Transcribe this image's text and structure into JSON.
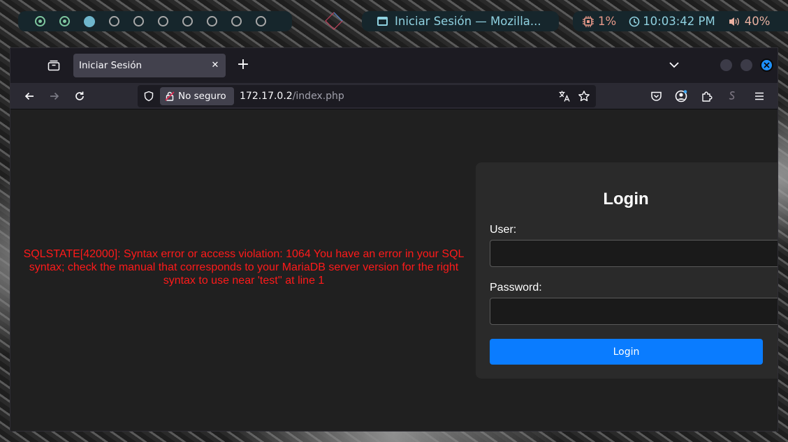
{
  "topbar": {
    "workspaces": [
      "used",
      "used",
      "active",
      "empty",
      "empty",
      "empty",
      "empty",
      "empty",
      "empty",
      "empty"
    ],
    "window_title": "Iniciar Sesión — Mozilla...",
    "cpu": "1%",
    "clock": "10:03:42 PM",
    "volume": "40%"
  },
  "browser": {
    "tab_title": "Iniciar Sesión",
    "close_tab_glyph": "✕",
    "new_tab_glyph": "+",
    "security_label": "No seguro",
    "url_host": "172.17.0.2",
    "url_path": "/index.php"
  },
  "page": {
    "error_message": "SQLSTATE[42000]: Syntax error or access violation: 1064 You have an error in your SQL syntax; check the manual that corresponds to your MariaDB server version for the right syntax to use near 'test'' at line 1",
    "login": {
      "title": "Login",
      "user_label": "User:",
      "user_value": "",
      "password_label": "Password:",
      "password_value": "",
      "button_label": "Login"
    }
  },
  "colors": {
    "accent_blue": "#0a7cff",
    "error_red": "#ff1a1a",
    "workspace_green": "#7ec8a0",
    "workspace_active": "#6fb6cc"
  }
}
